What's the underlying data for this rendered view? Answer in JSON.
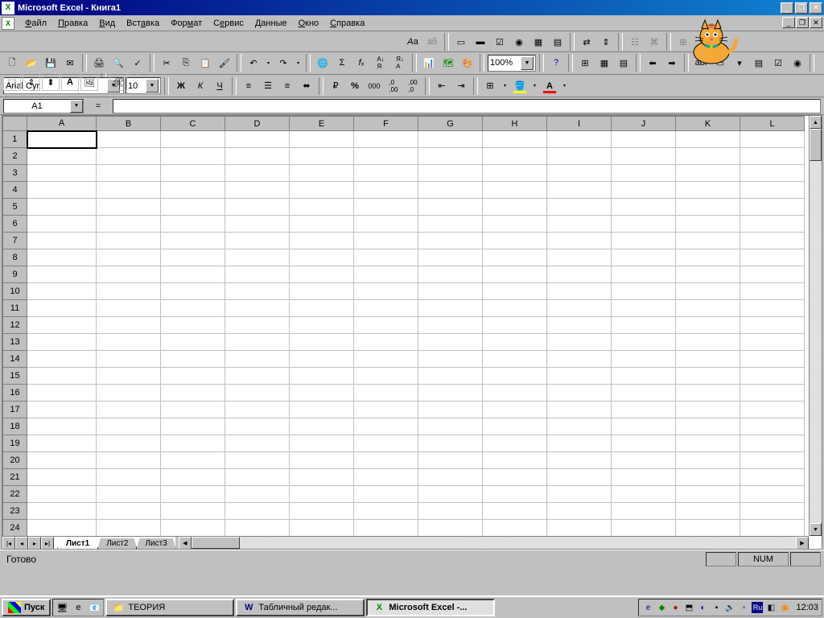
{
  "title": "Microsoft Excel - Книга1",
  "menu": [
    "Файл",
    "Правка",
    "Вид",
    "Вставка",
    "Формат",
    "Сервис",
    "Данные",
    "Окно",
    "Справка"
  ],
  "toolbar1": {
    "items": [
      "Aa",
      "аб",
      "□",
      "✎",
      "☑",
      "◯",
      "▦",
      "▤",
      "⇄",
      "▭",
      "⊞",
      "⊟",
      "⬚",
      "⚒"
    ]
  },
  "toolbar2": {
    "zoom": "100%"
  },
  "formatting": {
    "font": "Arial Cyr",
    "size": "10",
    "bold": "Ж",
    "italic": "К",
    "underline": "Ч"
  },
  "name_box": "A1",
  "formula_eq": "=",
  "columns": [
    "A",
    "B",
    "C",
    "D",
    "E",
    "F",
    "G",
    "H",
    "I",
    "J",
    "K",
    "L"
  ],
  "rows": [
    1,
    2,
    3,
    4,
    5,
    6,
    7,
    8,
    9,
    10,
    11,
    12,
    13,
    14,
    15,
    16,
    17,
    18,
    19,
    20,
    21,
    22,
    23,
    24
  ],
  "sheet_tabs": [
    "Лист1",
    "Лист2",
    "Лист3"
  ],
  "status": {
    "ready": "Готово",
    "num": "NUM"
  },
  "taskbar": {
    "start": "Пуск",
    "tasks": [
      {
        "label": "ТЕОРИЯ",
        "icon": "📁",
        "active": false
      },
      {
        "label": "Табличный редак...",
        "icon": "W",
        "active": false
      },
      {
        "label": "Microsoft Excel -...",
        "icon": "X",
        "active": true
      }
    ],
    "lang": "Ru",
    "clock": "12:03"
  }
}
